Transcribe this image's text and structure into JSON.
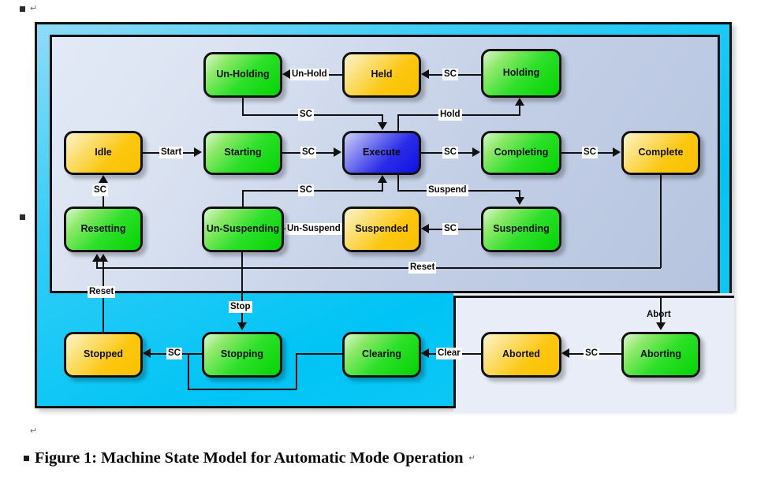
{
  "document": {
    "caption": "Figure 1: Machine State Model for Automatic Mode Operation",
    "paragraph_mark": "↵",
    "bullet": "■"
  },
  "diagram": {
    "title": "Machine State Model for Automatic Mode Operation",
    "colors": {
      "outer_region": "#00c4f5",
      "inner_panel": "#c3cfe6",
      "state_green": "#2ee02a",
      "state_yellow": "#fcc710",
      "state_blue": "#2b2ce8",
      "border": "#111111",
      "label_background": "#ffffff"
    },
    "states": [
      {
        "id": "un-holding",
        "label": "Un-Holding",
        "color": "green"
      },
      {
        "id": "held",
        "label": "Held",
        "color": "yellow"
      },
      {
        "id": "holding",
        "label": "Holding",
        "color": "green"
      },
      {
        "id": "idle",
        "label": "Idle",
        "color": "yellow"
      },
      {
        "id": "starting",
        "label": "Starting",
        "color": "green"
      },
      {
        "id": "execute",
        "label": "Execute",
        "color": "blue"
      },
      {
        "id": "completing",
        "label": "Completing",
        "color": "green"
      },
      {
        "id": "complete",
        "label": "Complete",
        "color": "yellow"
      },
      {
        "id": "resetting",
        "label": "Resetting",
        "color": "green"
      },
      {
        "id": "un-suspending",
        "label": "Un-Suspending",
        "color": "green"
      },
      {
        "id": "suspended",
        "label": "Suspended",
        "color": "yellow"
      },
      {
        "id": "suspending",
        "label": "Suspending",
        "color": "green"
      },
      {
        "id": "stopped",
        "label": "Stopped",
        "color": "yellow"
      },
      {
        "id": "stopping",
        "label": "Stopping",
        "color": "green"
      },
      {
        "id": "clearing",
        "label": "Clearing",
        "color": "green"
      },
      {
        "id": "aborted",
        "label": "Aborted",
        "color": "yellow"
      },
      {
        "id": "aborting",
        "label": "Aborting",
        "color": "green"
      }
    ],
    "transitions": [
      {
        "id": "held-to-unholding",
        "label": "Un-Hold",
        "from": "held",
        "to": "un-holding"
      },
      {
        "id": "holding-to-held",
        "label": "SC",
        "from": "holding",
        "to": "held"
      },
      {
        "id": "unholding-to-execute",
        "label": "SC",
        "from": "un-holding",
        "to": "execute"
      },
      {
        "id": "execute-to-holding",
        "label": "Hold",
        "from": "execute",
        "to": "holding"
      },
      {
        "id": "idle-to-starting",
        "label": "Start",
        "from": "idle",
        "to": "starting"
      },
      {
        "id": "starting-to-execute",
        "label": "SC",
        "from": "starting",
        "to": "execute"
      },
      {
        "id": "execute-to-completing",
        "label": "SC",
        "from": "execute",
        "to": "completing"
      },
      {
        "id": "completing-to-complete",
        "label": "SC",
        "from": "completing",
        "to": "complete"
      },
      {
        "id": "resetting-to-idle",
        "label": "SC",
        "from": "resetting",
        "to": "idle"
      },
      {
        "id": "unsuspending-to-execute",
        "label": "SC",
        "from": "un-suspending",
        "to": "execute"
      },
      {
        "id": "suspended-to-unsuspending",
        "label": "Un-Suspend",
        "from": "suspended",
        "to": "un-suspending"
      },
      {
        "id": "suspending-to-suspended",
        "label": "SC",
        "from": "suspending",
        "to": "suspended"
      },
      {
        "id": "execute-to-suspending",
        "label": "Suspend",
        "from": "execute",
        "to": "suspending"
      },
      {
        "id": "complete-to-resetting",
        "label": "Reset",
        "from": "complete",
        "to": "resetting"
      },
      {
        "id": "stopped-to-resetting",
        "label": "Reset",
        "from": "stopped",
        "to": "resetting"
      },
      {
        "id": "any-to-stopping",
        "label": "Stop",
        "from": "automatic-mode",
        "to": "stopping"
      },
      {
        "id": "stopping-to-stopped",
        "label": "SC",
        "from": "stopping",
        "to": "stopped"
      },
      {
        "id": "clearing-to-stopping",
        "label": "",
        "from": "clearing",
        "to": "stopping"
      },
      {
        "id": "aborted-to-clearing",
        "label": "Clear",
        "from": "aborted",
        "to": "clearing"
      },
      {
        "id": "aborting-to-aborted",
        "label": "SC",
        "from": "aborting",
        "to": "aborted"
      },
      {
        "id": "any-to-aborting",
        "label": "Abort",
        "from": "machine",
        "to": "aborting"
      }
    ]
  }
}
